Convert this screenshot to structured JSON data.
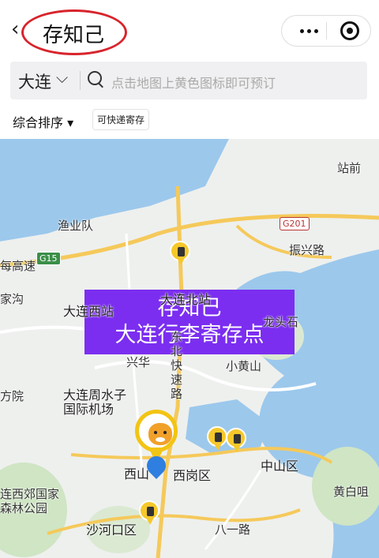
{
  "header": {
    "back_icon": "‹",
    "title": "存知己"
  },
  "search": {
    "city": "大连",
    "placeholder": "点击地图上黄色图标即可预订"
  },
  "filters": {
    "sort_label": "综合排序 ▾",
    "chip_label": "可快递寄存"
  },
  "banner": {
    "line1": "存知己",
    "line2": "大连行李寄存点"
  },
  "map_labels": {
    "zhanqian": "站前",
    "yuyedui": "渔业队",
    "gaosu": "每高速",
    "jiagou": "家沟",
    "dalian_xizhan": "大连西站",
    "dalian_beizhan": "大连北站",
    "longtoushi": "龙头石",
    "zhenxinglu": "振兴路",
    "dongbei": "东北快速路",
    "xinghua": "兴华",
    "xiaohuangshan": "小黄山",
    "fangyuan": "方院",
    "airport": "大连周水子国际机场",
    "zhongshan": "中山区",
    "xishan": "西山",
    "xigang": "西岗区",
    "huangbaizui": "黄白咀",
    "lianxi": "连西郊国家森林公园",
    "shahekou": "沙河口区",
    "bayilu": "八一路",
    "g15": "G15",
    "g201": "G201"
  },
  "colors": {
    "accent": "#7b2ef0",
    "pin_yellow": "#f6c82a",
    "water": "#9cc8ec"
  }
}
